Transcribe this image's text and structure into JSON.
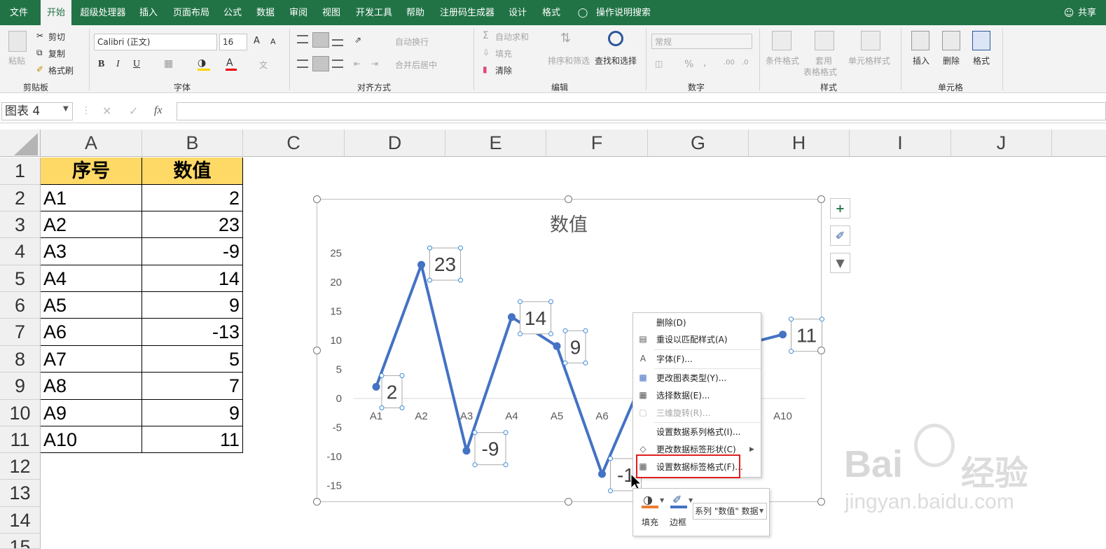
{
  "ribbon_tabs": [
    "文件",
    "开始",
    "超级处理器",
    "插入",
    "页面布局",
    "公式",
    "数据",
    "审阅",
    "视图",
    "开发工具",
    "帮助",
    "注册码生成器",
    "设计",
    "格式"
  ],
  "search_label": "操作说明搜索",
  "share_label": "共享",
  "clipboard": {
    "paste": "粘贴",
    "cut": "剪切",
    "copy": "复制",
    "format_painter": "格式刷",
    "group": "剪贴板"
  },
  "font": {
    "name": "Calibri (正文)",
    "size": "16",
    "bold": "B",
    "italic": "I",
    "underline": "U",
    "grow": "A",
    "shrink": "A",
    "group": "字体"
  },
  "alignment": {
    "wrap": "自动换行",
    "merge": "合并后居中",
    "group": "对齐方式"
  },
  "editing": {
    "autosum": "自动求和",
    "fill": "填充",
    "clear": "清除",
    "sort": "排序和筛选",
    "find": "查找和选择",
    "group": "编辑"
  },
  "number": {
    "format": "常规",
    "percent": "%",
    "comma": ",",
    "group": "数字"
  },
  "styles": {
    "conditional": "条件格式",
    "table": "套用\n表格格式",
    "cell_styles": "单元格样式",
    "group": "样式"
  },
  "cells": {
    "insert": "插入",
    "delete": "删除",
    "format": "格式",
    "group": "单元格"
  },
  "name_box": "图表 4",
  "fx": "fx",
  "columns": [
    "A",
    "B",
    "C",
    "D",
    "E",
    "F",
    "G",
    "H",
    "I",
    "J"
  ],
  "rows": [
    "1",
    "2",
    "3",
    "4",
    "5",
    "6",
    "7",
    "8",
    "9",
    "10",
    "11",
    "12",
    "13",
    "14",
    "15"
  ],
  "table": {
    "header": [
      "序号",
      "数值"
    ],
    "rows": [
      [
        "A1",
        "2"
      ],
      [
        "A2",
        "23"
      ],
      [
        "A3",
        "-9"
      ],
      [
        "A4",
        "14"
      ],
      [
        "A5",
        "9"
      ],
      [
        "A6",
        "-13"
      ],
      [
        "A7",
        "5"
      ],
      [
        "A8",
        "7"
      ],
      [
        "A9",
        "9"
      ],
      [
        "A10",
        "11"
      ]
    ]
  },
  "chart_data": {
    "type": "line",
    "title": "数值",
    "categories": [
      "A1",
      "A2",
      "A3",
      "A4",
      "A5",
      "A6",
      "A7",
      "A8",
      "A9",
      "A10"
    ],
    "series": [
      {
        "values": [
          2,
          23,
          -9,
          14,
          9,
          -13,
          5,
          7,
          9,
          11
        ]
      }
    ],
    "ylim": [
      -15,
      25
    ],
    "yticks": [
      25,
      20,
      15,
      10,
      5,
      0,
      -5,
      -10,
      -15
    ],
    "visible_tick_labels": [
      "A1",
      "A2",
      "A3",
      "A4",
      "A5",
      "A6",
      "A10"
    ],
    "visible_data_labels": [
      "2",
      "23",
      "-9",
      "14",
      "9",
      "-1",
      "11"
    ],
    "grid": false,
    "line_color": "#4472c4"
  },
  "side_buttons": [
    "+",
    "brush",
    "filter"
  ],
  "context_menu": [
    {
      "label": "删除(D)",
      "icon": "",
      "disabled": false
    },
    {
      "label": "重设以匹配样式(A)",
      "icon": "reset-icon",
      "disabled": false
    },
    {
      "label": "字体(F)...",
      "icon": "font-icon",
      "disabled": false
    },
    {
      "label": "更改图表类型(Y)...",
      "icon": "chart-type-icon",
      "disabled": false
    },
    {
      "label": "选择数据(E)...",
      "icon": "select-data-icon",
      "disabled": false
    },
    {
      "label": "三维旋转(R)...",
      "icon": "rotate-3d-icon",
      "disabled": true
    },
    {
      "label": "设置数据系列格式(I)...",
      "icon": "",
      "disabled": false
    },
    {
      "label": "更改数据标签形状(C)",
      "icon": "shape-icon",
      "disabled": false,
      "submenu": true
    },
    {
      "label": "设置数据标签格式(F)...",
      "icon": "format-label-icon",
      "disabled": false,
      "highlighted": true
    }
  ],
  "mini_toolbar": {
    "fill": "填充",
    "border": "边框",
    "series": "系列 \"数值\" 数据"
  },
  "watermark": {
    "brand": "Bai",
    "brand_cn": "经验",
    "url": "jingyan.baidu.com"
  }
}
